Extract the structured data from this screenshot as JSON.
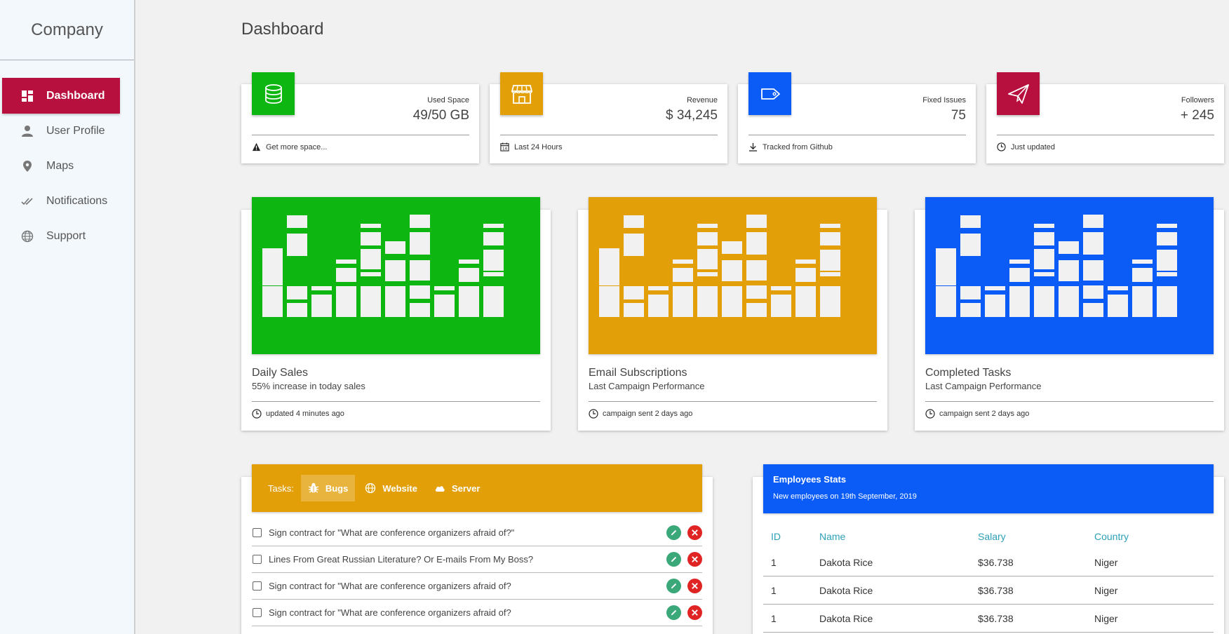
{
  "brand": "Company",
  "page_title": "Dashboard",
  "nav": [
    {
      "label": "Dashboard",
      "icon": "dashboard-icon"
    },
    {
      "label": "User Profile",
      "icon": "person-icon"
    },
    {
      "label": "Maps",
      "icon": "map-pin-icon"
    },
    {
      "label": "Notifications",
      "icon": "double-check-icon"
    },
    {
      "label": "Support",
      "icon": "globe-icon"
    }
  ],
  "stats": [
    {
      "label": "Used Space",
      "value": "49/50 GB",
      "footer": "Get more space...",
      "icon": "database-icon",
      "foot_icon": "warning-icon",
      "color": "#0eb611"
    },
    {
      "label": "Revenue",
      "value": "$ 34,245",
      "footer": "Last 24 Hours",
      "icon": "store-icon",
      "foot_icon": "calendar-icon",
      "color": "#e39f08"
    },
    {
      "label": "Fixed Issues",
      "value": "75",
      "footer": "Tracked from Github",
      "icon": "tag-icon",
      "foot_icon": "download-icon",
      "color": "#0b5cf7"
    },
    {
      "label": "Followers",
      "value": "+ 245",
      "footer": "Just updated",
      "icon": "paper-plane-icon",
      "foot_icon": "clock-icon",
      "color": "#b8103e"
    }
  ],
  "charts": [
    {
      "title": "Daily Sales",
      "subtitle": "55% increase in today sales",
      "footer": "updated 4 minutes ago",
      "color": "#0eb611"
    },
    {
      "title": "Email Subscriptions",
      "subtitle": "Last Campaign Performance",
      "footer": "campaign sent 2 days ago",
      "color": "#e39f08"
    },
    {
      "title": "Completed Tasks",
      "subtitle": "Last Campaign Performance",
      "footer": "campaign sent 2 days ago",
      "color": "#0b5cf7"
    }
  ],
  "tasks": {
    "label": "Tasks:",
    "tabs": [
      {
        "label": "Bugs",
        "icon": "bug-icon"
      },
      {
        "label": "Website",
        "icon": "globe-icon"
      },
      {
        "label": "Server",
        "icon": "cloud-icon"
      }
    ],
    "items": [
      "Sign contract for \"What are conference organizers afraid of?\"",
      "Lines From Great Russian Literature? Or E-mails From My Boss?",
      "Sign contract for \"What are conference organizers afraid of?",
      "Sign contract for \"What are conference organizers afraid of?"
    ]
  },
  "employees": {
    "title": "Employees Stats",
    "subtitle": "New employees on 19th September, 2019",
    "columns": [
      "ID",
      "Name",
      "Salary",
      "Country"
    ],
    "rows": [
      [
        "1",
        "Dakota Rice",
        "$36.738",
        "Niger"
      ],
      [
        "1",
        "Dakota Rice",
        "$36.738",
        "Niger"
      ],
      [
        "1",
        "Dakota Rice",
        "$36.738",
        "Niger"
      ]
    ]
  }
}
